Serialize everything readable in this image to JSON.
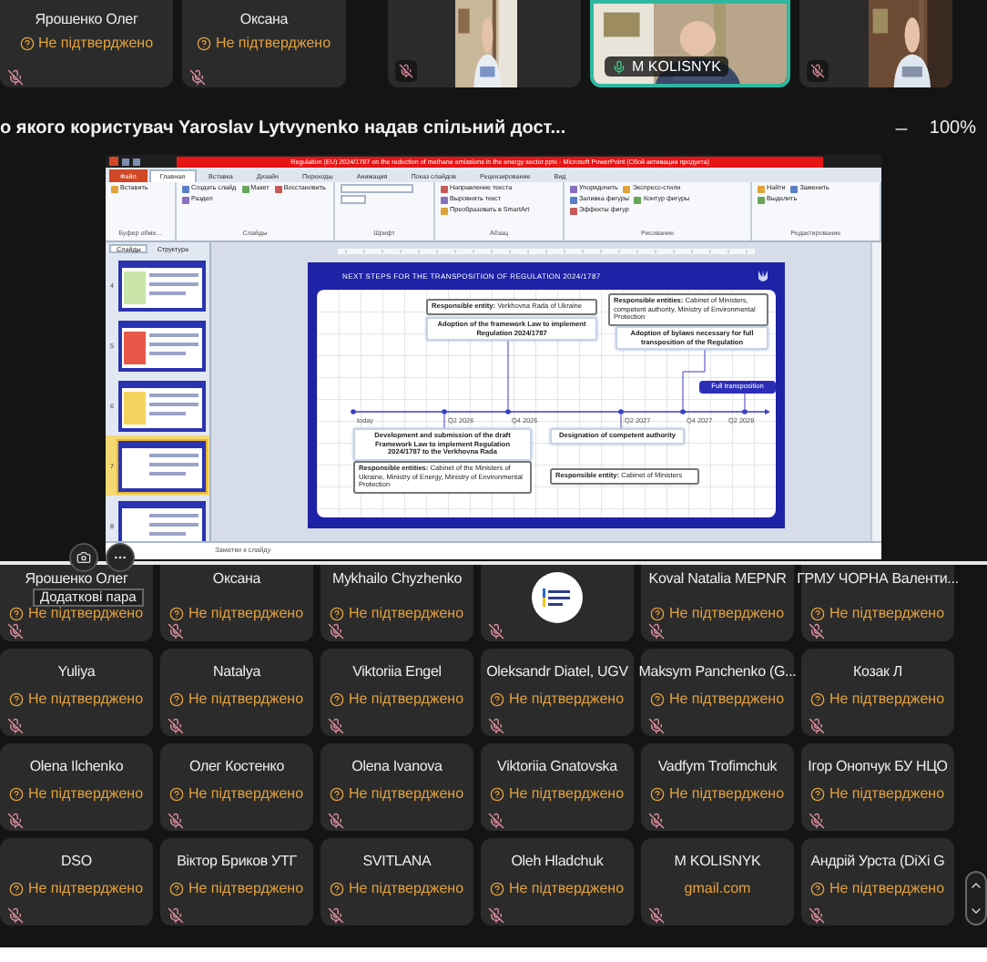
{
  "top_strip": {
    "tiles": [
      {
        "kind": "person",
        "name": "Ярошенко Олег",
        "status": "Не підтверджено"
      },
      {
        "kind": "person",
        "name": "Оксана",
        "status": "Не підтверджено"
      },
      {
        "kind": "video",
        "muted": true,
        "active": false
      },
      {
        "kind": "video",
        "muted": false,
        "active": true,
        "name": "M KOLISNYK"
      },
      {
        "kind": "video",
        "muted": true,
        "active": false
      }
    ]
  },
  "share_bar": {
    "caption": "о якого користувач Yaroslav Lytvynenko надав спільний дост...",
    "zoom": "100%"
  },
  "presentation": {
    "window_title": "Regulation (EU) 2024/1787 on the reduction of methane emissions in the energy sector.pptx - Microsoft PowerPoint (Сбой активации продукта)",
    "ribbon_tabs": [
      {
        "label": "Файл",
        "kind": "file",
        "selected": false
      },
      {
        "label": "Главная",
        "kind": "tab",
        "selected": true
      },
      {
        "label": "Вставка",
        "kind": "tab",
        "selected": false
      },
      {
        "label": "Дизайн",
        "kind": "tab",
        "selected": false
      },
      {
        "label": "Переходы",
        "kind": "tab",
        "selected": false
      },
      {
        "label": "Анимация",
        "kind": "tab",
        "selected": false
      },
      {
        "label": "Показ слайдов",
        "kind": "tab",
        "selected": false
      },
      {
        "label": "Рецензирование",
        "kind": "tab",
        "selected": false
      },
      {
        "label": "Вид",
        "kind": "tab",
        "selected": false
      }
    ],
    "ribbon_groups": [
      {
        "label": "Буфер обме...",
        "buttons": [
          "Вставить"
        ]
      },
      {
        "label": "Слайды",
        "buttons": [
          "Создать слайд",
          "Макет",
          "Восстановить",
          "Раздел"
        ]
      },
      {
        "label": "Шрифт"
      },
      {
        "label": "Абзац",
        "buttons": [
          "Направление текста",
          "Выровнять текст",
          "Преобразовать в SmartArt"
        ]
      },
      {
        "label": "Рисование",
        "buttons": [
          "Упорядочить",
          "Экспресс-стили",
          "Заливка фигуры",
          "Контур фигуры",
          "Эффекты фигур"
        ]
      },
      {
        "label": "Редактирование",
        "buttons": [
          "Найти",
          "Заменить",
          "Выделить"
        ]
      }
    ],
    "panel_tabs": [
      {
        "label": "Слайды",
        "selected": true
      },
      {
        "label": "Структура",
        "selected": false
      }
    ],
    "thumbnails": [
      {
        "number": "4",
        "selected": false
      },
      {
        "number": "5",
        "selected": false
      },
      {
        "number": "6",
        "selected": false
      },
      {
        "number": "7",
        "selected": true
      },
      {
        "number": "8",
        "selected": false
      }
    ],
    "slide": {
      "title": "NEXT STEPS FOR THE TRANSPOSITION OF REGULATION 2024/1787",
      "nodes": [
        {
          "kind": "label",
          "text": "**Responsible entity:** Verkhovna Rada of Ukraine"
        },
        {
          "kind": "step",
          "text": "Adoption of the framework Law to implement Regulation 2024/1787"
        },
        {
          "kind": "label",
          "text": "**Responsible entities:** Cabinet of Ministers, competent authority, Ministry of Environmental Protection"
        },
        {
          "kind": "step",
          "text": "Adoption of bylaws necessary for full transposition of the Regulation"
        },
        {
          "kind": "highlight",
          "text": "Full transposition"
        },
        {
          "kind": "step",
          "text": "Development and submission of the draft Framework Law to implement Regulation 2024/1787 to the Verkhovna Rada"
        },
        {
          "kind": "label",
          "text": "**Responsible entities:** Cabinet of the Ministers of Ukraine, Ministry of Energy, Ministry of Environmental Protection"
        },
        {
          "kind": "step",
          "text": "Designation of competent authority"
        },
        {
          "kind": "label",
          "text": "**Responsible entity:** Cabinet of Ministers"
        }
      ],
      "timeline": [
        "today",
        "Q2 2026",
        "Q4 2026",
        "Q2 2027",
        "Q4 2027",
        "Q2 2028"
      ]
    },
    "notes_placeholder": "Заметки к слайду"
  },
  "grid": {
    "tooltip": "Додаткові пара",
    "tiles": [
      {
        "kind": "unconfirmed",
        "name": "Ярошенко Олег",
        "note": "Не підтверджено"
      },
      {
        "kind": "unconfirmed",
        "name": "Оксана",
        "note": "Не підтверджено"
      },
      {
        "kind": "unconfirmed",
        "name": "Mykhailo Chyzhenko",
        "note": "Не підтверджено"
      },
      {
        "kind": "logo"
      },
      {
        "kind": "unconfirmed",
        "name": "Koval Natalia MEPNR",
        "note": "Не підтверджено"
      },
      {
        "kind": "unconfirmed",
        "name": "ГРМУ ЧОРНА Валенти...",
        "note": "Не підтверджено"
      },
      {
        "kind": "unconfirmed",
        "name": "Yuliya",
        "note": "Не підтверджено"
      },
      {
        "kind": "unconfirmed",
        "name": "Natalya",
        "note": "Не підтверджено"
      },
      {
        "kind": "unconfirmed",
        "name": "Viktoriia Engel",
        "note": "Не підтверджено"
      },
      {
        "kind": "unconfirmed",
        "name": "Oleksandr Diatel, UGV",
        "note": "Не підтверджено"
      },
      {
        "kind": "unconfirmed",
        "name": "Maksym Panchenko (G...",
        "note": "Не підтверджено"
      },
      {
        "kind": "unconfirmed",
        "name": "Козак Л",
        "note": "Не підтверджено"
      },
      {
        "kind": "unconfirmed",
        "name": "Olena Ilchenko",
        "note": "Не підтверджено"
      },
      {
        "kind": "unconfirmed",
        "name": "Олег Костенко",
        "note": "Не підтверджено"
      },
      {
        "kind": "unconfirmed",
        "name": "Olena Ivanova",
        "note": "Не підтверджено"
      },
      {
        "kind": "unconfirmed",
        "name": "Viktoriia Gnatovska",
        "note": "Не підтверджено"
      },
      {
        "kind": "unconfirmed",
        "name": "Vadfym Trofimchuk",
        "note": "Не підтверджено"
      },
      {
        "kind": "unconfirmed",
        "name": "Ігор Онопчук БУ НЦО",
        "note": "Не підтверджено"
      },
      {
        "kind": "unconfirmed",
        "name": "DSO",
        "note": "Не підтверджено"
      },
      {
        "kind": "unconfirmed",
        "name": "Віктор Бриков УТГ",
        "note": "Не підтверджено"
      },
      {
        "kind": "unconfirmed",
        "name": "SVITLANA",
        "note": "Не підтверджено"
      },
      {
        "kind": "unconfirmed",
        "name": "Oleh Hladchuk",
        "note": "Не підтверджено"
      },
      {
        "kind": "email",
        "name": "M KOLISNYK",
        "note": "gmail.com"
      },
      {
        "kind": "unconfirmed",
        "name": "Андрій Урста (DiXi G",
        "note": "Не підтверджено"
      }
    ]
  }
}
